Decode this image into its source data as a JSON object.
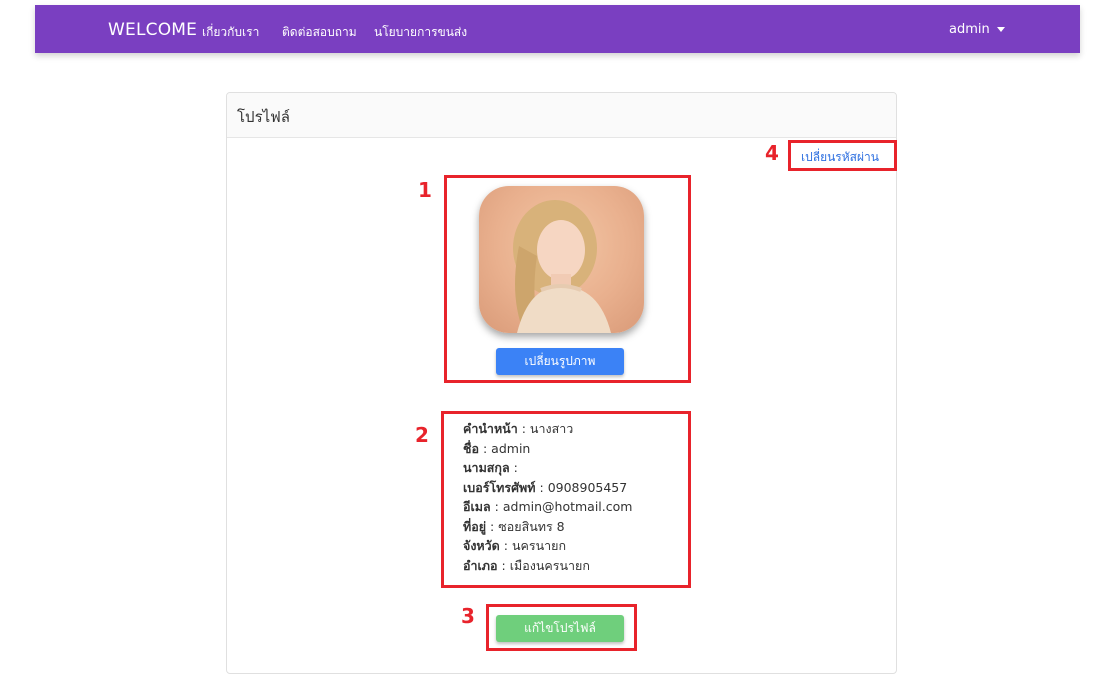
{
  "navbar": {
    "brand": "WELCOME",
    "links": [
      "เกี่ยวกับเรา",
      "ติดต่อสอบถาม",
      "นโยบายการขนส่ง"
    ],
    "user": "admin"
  },
  "card": {
    "title": "โปรไฟล์",
    "change_password_link": "เปลี่ยนรหัสผ่าน",
    "change_photo_button": "เปลี่ยนรูปภาพ",
    "edit_profile_button": "แก้ไขโปรไฟล์"
  },
  "annotations": [
    "1",
    "2",
    "3",
    "4"
  ],
  "profile": [
    {
      "label": "คำนำหน้า",
      "value": "นางสาว"
    },
    {
      "label": "ชื่อ",
      "value": "admin"
    },
    {
      "label": "นามสกุล",
      "value": ""
    },
    {
      "label": "เบอร์โทรศัพท์",
      "value": "0908905457"
    },
    {
      "label": "อีเมล",
      "value": "admin@hotmail.com"
    },
    {
      "label": "ที่อยู่",
      "value": "ซอยสินทร 8"
    },
    {
      "label": "จังหวัด",
      "value": "นครนายก"
    },
    {
      "label": "อำเภอ",
      "value": "เมืองนครนายก"
    }
  ],
  "colors": {
    "navbar": "#7a3fc1",
    "annotation_red": "#e8232b",
    "primary_button": "#3b82f6",
    "success_button": "#6fcf7c",
    "link": "#2d6fe0"
  }
}
